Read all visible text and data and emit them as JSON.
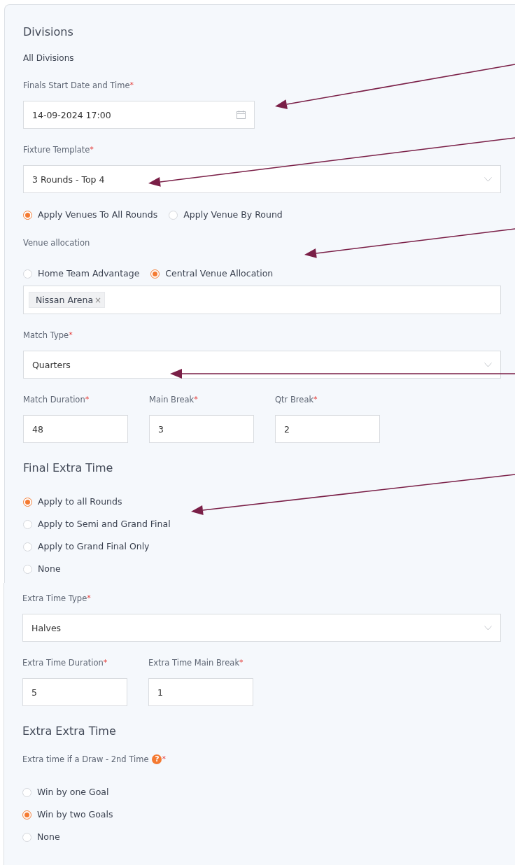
{
  "panels": [
    {
      "items": [
        {
          "kind": "heading",
          "text": "Divisions"
        },
        {
          "kind": "note",
          "text": "All Divisions"
        },
        {
          "kind": "field",
          "label": "Finals Start Date and Time",
          "required_mark": "*",
          "control": {
            "kind": "date",
            "value": "14-09-2024 17:00"
          }
        },
        {
          "kind": "field",
          "label": "Fixture Template",
          "required_mark": "*",
          "control": {
            "kind": "select",
            "value": "3 Rounds - Top 4"
          }
        },
        {
          "kind": "radio-inline",
          "options": [
            {
              "label": "Apply Venues To All Rounds",
              "selected": true
            },
            {
              "label": "Apply Venue By Round",
              "selected": false
            }
          ]
        },
        {
          "kind": "venue",
          "label": "Venue allocation",
          "options": [
            {
              "label": "Home Team Advantage",
              "selected": false
            },
            {
              "label": "Central Venue Allocation",
              "selected": true
            }
          ],
          "tags": [
            {
              "label": "Nissan Arena",
              "remove": "×"
            }
          ]
        },
        {
          "kind": "field",
          "label": "Match Type",
          "required_mark": "*",
          "control": {
            "kind": "select",
            "value": "Quarters"
          }
        },
        {
          "kind": "row",
          "fields": [
            {
              "label": "Match Duration",
              "required_mark": "*",
              "value": "48"
            },
            {
              "label": "Main Break",
              "required_mark": "*",
              "value": "3"
            },
            {
              "label": "Qtr Break",
              "required_mark": "*",
              "value": "2"
            }
          ]
        },
        {
          "kind": "heading",
          "text": "Final Extra Time"
        },
        {
          "kind": "radio-stack",
          "options": [
            {
              "label": "Apply to all Rounds",
              "selected": true
            },
            {
              "label": "Apply to Semi and Grand Final",
              "selected": false
            },
            {
              "label": "Apply to Grand Final Only",
              "selected": false
            },
            {
              "label": "None",
              "selected": false
            }
          ]
        }
      ]
    },
    {
      "items": [
        {
          "kind": "field",
          "label": "Extra Time Type",
          "required_mark": "*",
          "control": {
            "kind": "select",
            "value": "Halves"
          }
        },
        {
          "kind": "row",
          "fields": [
            {
              "label": "Extra Time Duration",
              "required_mark": "*",
              "value": "5"
            },
            {
              "label": "Extra Time Main Break",
              "required_mark": "*",
              "value": "1"
            }
          ]
        },
        {
          "kind": "heading",
          "text": "Extra Extra Time"
        },
        {
          "kind": "field",
          "label": "Extra time if a Draw - 2nd Time",
          "help_icon": "?",
          "required_mark": "*"
        },
        {
          "kind": "radio-stack",
          "options": [
            {
              "label": "Win by one Goal",
              "selected": false
            },
            {
              "label": "Win by two Goals",
              "selected": true
            },
            {
              "label": "None",
              "selected": false
            }
          ]
        }
      ]
    }
  ]
}
